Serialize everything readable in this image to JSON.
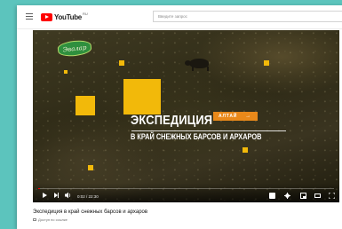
{
  "header": {
    "logo_text": "YouTube",
    "logo_region": "RU",
    "search_placeholder": "Введите запрос"
  },
  "video": {
    "brand_logo": "Эвалар",
    "overlay_title": "ЭКСПЕДИЦИЯ",
    "overlay_tag": "АЛТАЙ",
    "overlay_tag_arrow": "→",
    "overlay_subtitle": "В КРАЙ СНЕЖНЫХ БАРСОВ И АРХАРОВ",
    "time": "0:02 / 22:30",
    "progress": 0.002
  },
  "below": {
    "title": "Экспедиция в край снежных барсов и архаров",
    "meta": "Доступ по ссылке"
  },
  "colors": {
    "accent_yellow": "#f2b90a",
    "tag_orange": "#e9891a",
    "youtube_red": "#ff0000",
    "background": "#5cc4bd"
  }
}
